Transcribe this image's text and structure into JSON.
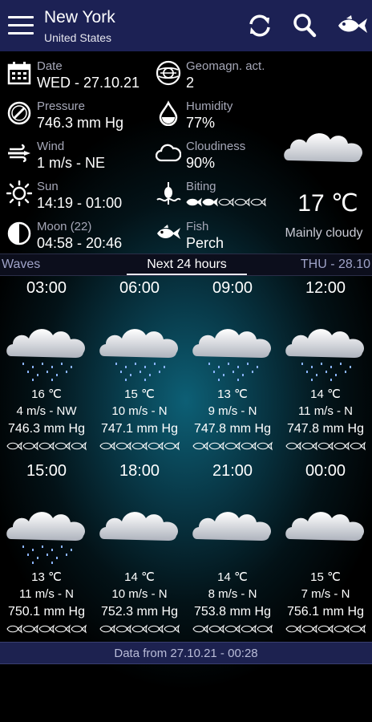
{
  "header": {
    "city": "New York",
    "country": "United States",
    "icons": [
      "menu-icon",
      "refresh-icon",
      "search-icon",
      "fish-icon"
    ]
  },
  "current": {
    "date": {
      "label": "Date",
      "value": "WED - 27.10.21",
      "icon": "calendar-icon"
    },
    "pressure": {
      "label": "Pressure",
      "value": "746.3 mm Hg",
      "icon": "barometer-icon"
    },
    "wind": {
      "label": "Wind",
      "value": "1 m/s - NE",
      "icon": "wind-icon"
    },
    "sun": {
      "label": "Sun",
      "value": "14:19 - 01:00",
      "icon": "sun-icon"
    },
    "moon": {
      "label": "Moon (22)",
      "value": "04:58 - 20:46",
      "icon": "moon-phase-icon"
    },
    "geomagnetic": {
      "label": "Geomagn. act.",
      "value": "2",
      "icon": "geomagnetic-icon"
    },
    "humidity": {
      "label": "Humidity",
      "value": "77%",
      "icon": "droplet-icon"
    },
    "cloudiness": {
      "label": "Cloudiness",
      "value": "90%",
      "icon": "cloud-outline-icon"
    },
    "biting": {
      "label": "Biting",
      "rating": 2,
      "max": 5,
      "icon": "float-icon"
    },
    "fish": {
      "label": "Fish",
      "value": "Perch",
      "icon": "fish-icon"
    },
    "temperature": "17 ℃",
    "condition": "Mainly cloudy"
  },
  "tabs": {
    "left": "Waves",
    "active": "Next 24 hours",
    "right": "THU - 28.10"
  },
  "forecast": [
    {
      "time": "03:00",
      "temp": "16 ℃",
      "wind": "4 m/s - NW",
      "pressure": "746.3 mm Hg",
      "rain": true,
      "bite": 0
    },
    {
      "time": "06:00",
      "temp": "15 ℃",
      "wind": "10 m/s - N",
      "pressure": "747.1 mm Hg",
      "rain": true,
      "bite": 0
    },
    {
      "time": "09:00",
      "temp": "13 ℃",
      "wind": "9 m/s - N",
      "pressure": "747.8 mm Hg",
      "rain": true,
      "bite": 0
    },
    {
      "time": "12:00",
      "temp": "14 ℃",
      "wind": "11 m/s - N",
      "pressure": "747.8 mm Hg",
      "rain": true,
      "bite": 0
    },
    {
      "time": "15:00",
      "temp": "13 ℃",
      "wind": "11 m/s - N",
      "pressure": "750.1 mm Hg",
      "rain": true,
      "bite": 0
    },
    {
      "time": "18:00",
      "temp": "14 ℃",
      "wind": "10 m/s - N",
      "pressure": "752.3 mm Hg",
      "rain": false,
      "bite": 0
    },
    {
      "time": "21:00",
      "temp": "14 ℃",
      "wind": "8 m/s - N",
      "pressure": "753.8 mm Hg",
      "rain": false,
      "bite": 0
    },
    {
      "time": "00:00",
      "temp": "15 ℃",
      "wind": "7 m/s - N",
      "pressure": "756.1 mm Hg",
      "rain": false,
      "bite": 0
    }
  ],
  "footer": "Data from 27.10.21 - 00:28"
}
